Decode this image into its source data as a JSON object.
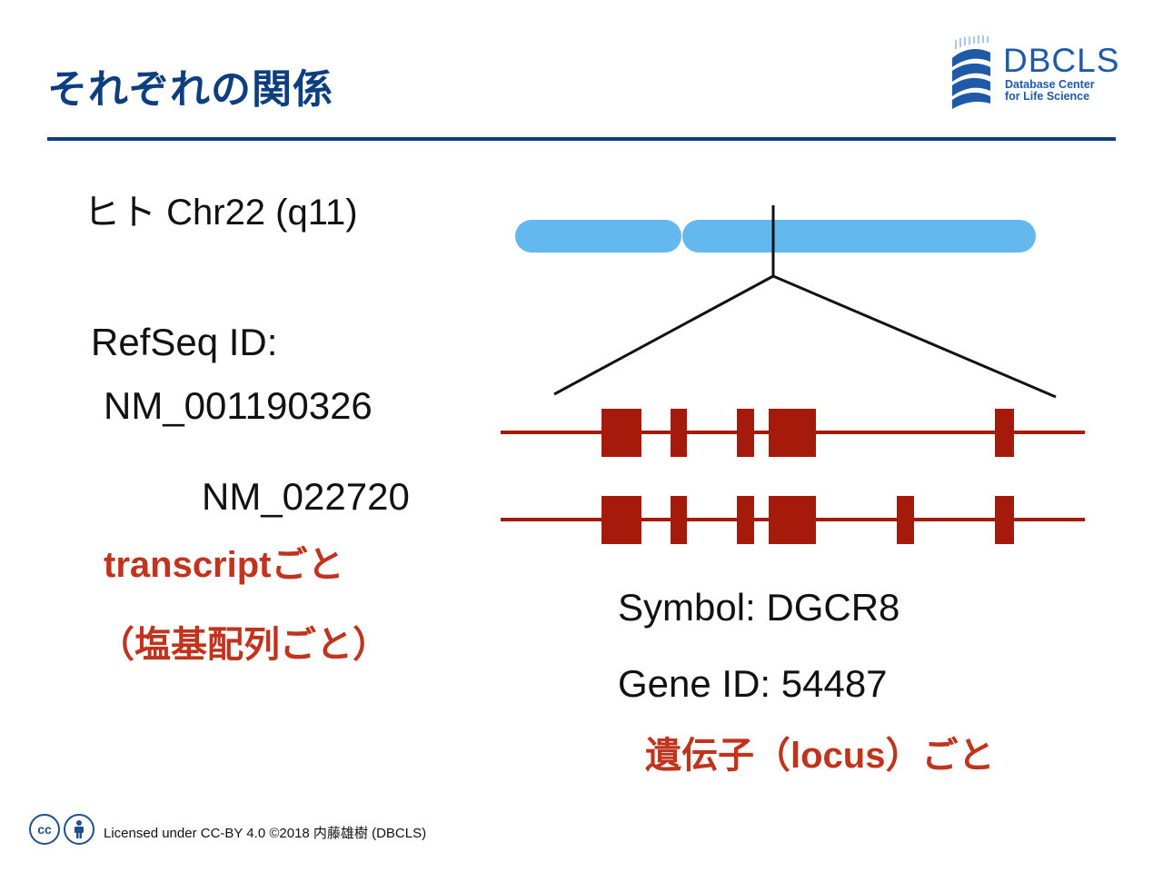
{
  "title": "それぞれの関係",
  "logo": {
    "name": "DBCLS",
    "subtitle_line1": "Database Center",
    "subtitle_line2": "for Life Science",
    "colors": {
      "blue": "#1f5aa8",
      "light_blue": "#7fb0e6"
    }
  },
  "chromosome": {
    "label": "ヒト Chr22 (q11)",
    "color": "#63b8ee"
  },
  "refseq": {
    "heading": "RefSeq ID:",
    "ids": [
      "NM_001190326",
      "NM_022720"
    ]
  },
  "transcripts": {
    "color": "#a61a0c",
    "exon_counts": [
      5,
      6
    ]
  },
  "annotations": {
    "transcript_note": "transcriptごと",
    "sequence_note": "（塩基配列ごと）",
    "symbol": "Symbol: DGCR8",
    "gene_id": "Gene ID: 54487",
    "gene_note": "遺伝子（locus）ごと",
    "red_color": "#c0341d"
  },
  "footer": {
    "license": "Licensed under CC-BY 4.0 ©2018 内藤雄樹 (DBCLS)",
    "cc_badge": "cc",
    "icons": [
      "cc-icon",
      "person-icon"
    ]
  }
}
